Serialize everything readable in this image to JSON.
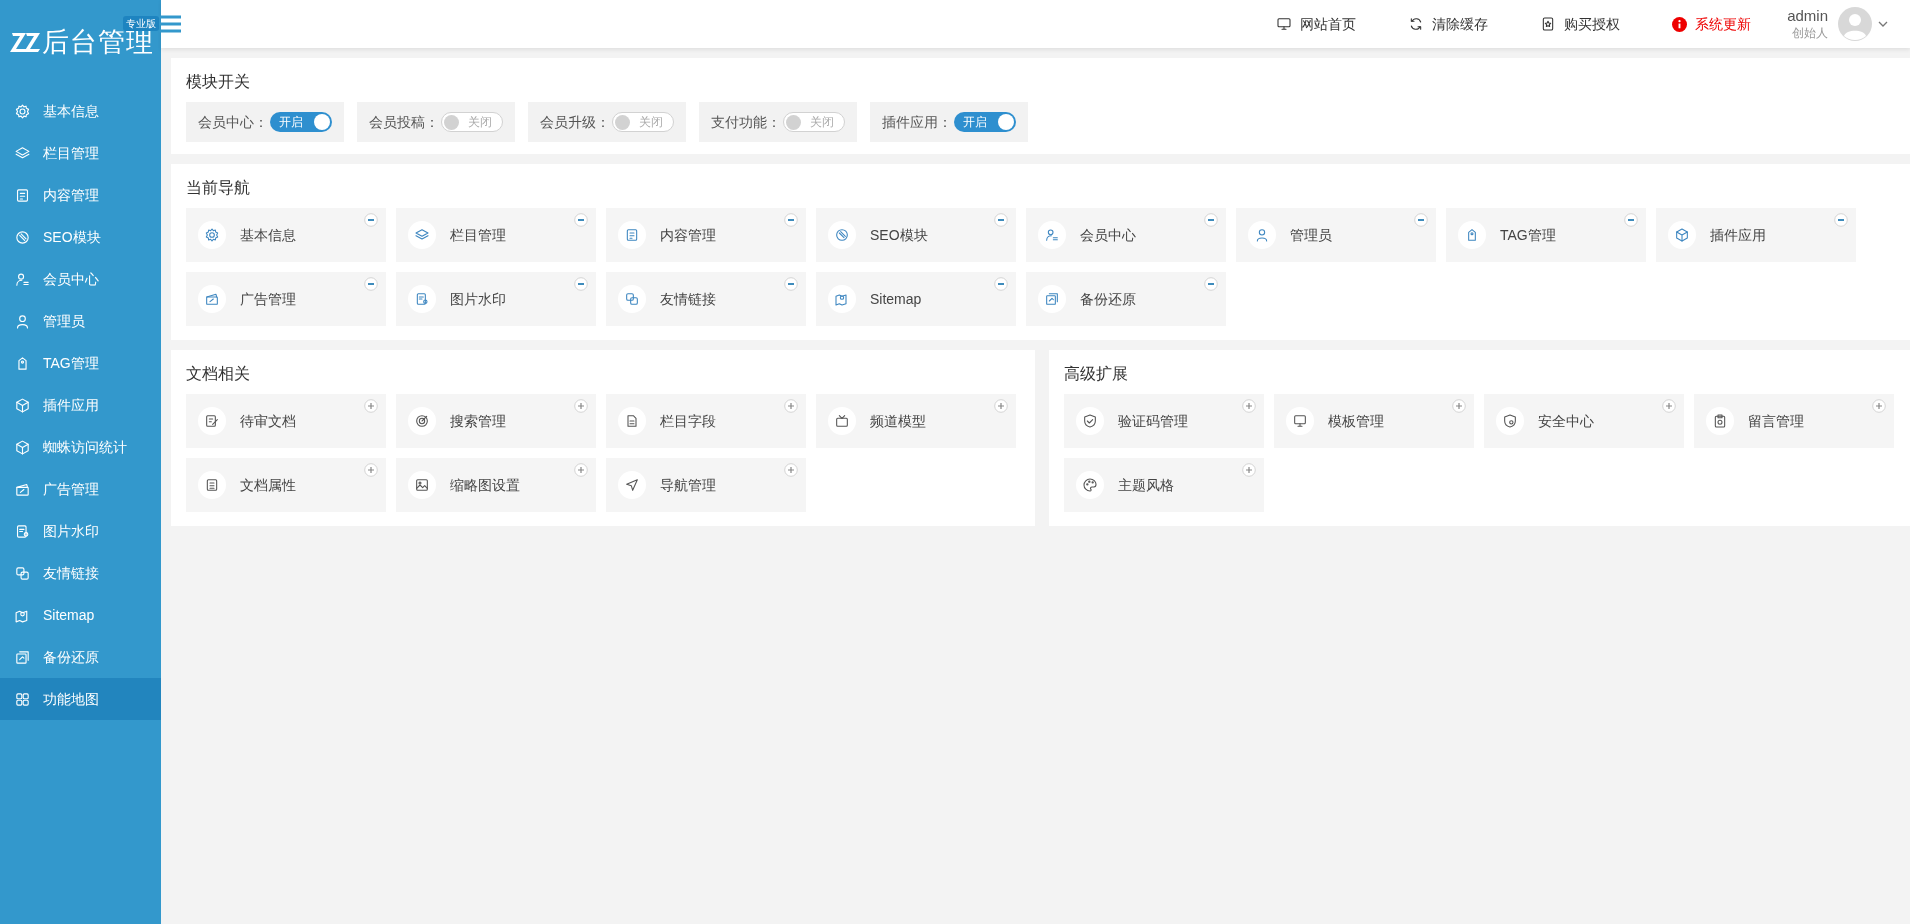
{
  "logo": {
    "text": "后台管理",
    "badge": "专业版"
  },
  "sidebar": {
    "items": [
      {
        "label": "基本信息",
        "selected": false
      },
      {
        "label": "栏目管理",
        "selected": false
      },
      {
        "label": "内容管理",
        "selected": false
      },
      {
        "label": "SEO模块",
        "selected": false
      },
      {
        "label": "会员中心",
        "selected": false
      },
      {
        "label": "管理员",
        "selected": false
      },
      {
        "label": "TAG管理",
        "selected": false
      },
      {
        "label": "插件应用",
        "selected": false
      },
      {
        "label": "蜘蛛访问统计",
        "selected": false
      },
      {
        "label": "广告管理",
        "selected": false
      },
      {
        "label": "图片水印",
        "selected": false
      },
      {
        "label": "友情链接",
        "selected": false
      },
      {
        "label": "Sitemap",
        "selected": false
      },
      {
        "label": "备份还原",
        "selected": false
      },
      {
        "label": "功能地图",
        "selected": true
      }
    ]
  },
  "topbar": {
    "links": [
      {
        "label": "网站首页",
        "kind": "normal"
      },
      {
        "label": "清除缓存",
        "kind": "normal"
      },
      {
        "label": "购买授权",
        "kind": "normal"
      },
      {
        "label": "系统更新",
        "kind": "alert"
      }
    ],
    "user": {
      "name": "admin",
      "role": "创始人"
    }
  },
  "module_switches": {
    "title": "模块开关",
    "items": [
      {
        "label": "会员中心：",
        "on": true,
        "state_text": "开启"
      },
      {
        "label": "会员投稿：",
        "on": false,
        "state_text": "关闭"
      },
      {
        "label": "会员升级：",
        "on": false,
        "state_text": "关闭"
      },
      {
        "label": "支付功能：",
        "on": false,
        "state_text": "关闭"
      },
      {
        "label": "插件应用：",
        "on": true,
        "state_text": "开启"
      }
    ]
  },
  "current_nav": {
    "title": "当前导航",
    "items": [
      "基本信息",
      "栏目管理",
      "内容管理",
      "SEO模块",
      "会员中心",
      "管理员",
      "TAG管理",
      "插件应用",
      "广告管理",
      "图片水印",
      "友情链接",
      "Sitemap",
      "备份还原"
    ]
  },
  "document_related": {
    "title": "文档相关",
    "items": [
      "待审文档",
      "搜索管理",
      "栏目字段",
      "频道模型",
      "文档属性",
      "缩略图设置",
      "导航管理"
    ]
  },
  "advanced": {
    "title": "高级扩展",
    "items": [
      "验证码管理",
      "模板管理",
      "安全中心",
      "留言管理",
      "主题风格"
    ]
  }
}
